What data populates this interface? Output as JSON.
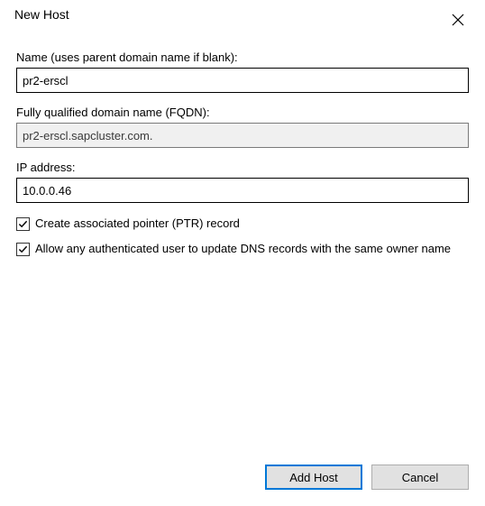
{
  "titlebar": {
    "title": "New Host"
  },
  "fields": {
    "name": {
      "label": "Name (uses parent domain name if blank):",
      "value": "pr2-erscl"
    },
    "fqdn": {
      "label": "Fully qualified domain name (FQDN):",
      "value": "pr2-erscl.sapcluster.com."
    },
    "ip": {
      "label": "IP address:",
      "value": "10.0.0.46"
    }
  },
  "checkboxes": {
    "ptr": {
      "label": "Create associated pointer (PTR) record",
      "checked": true
    },
    "allow_update": {
      "label": "Allow any authenticated user to update DNS records with the same owner name",
      "checked": true
    }
  },
  "buttons": {
    "add_host": "Add Host",
    "cancel": "Cancel"
  }
}
